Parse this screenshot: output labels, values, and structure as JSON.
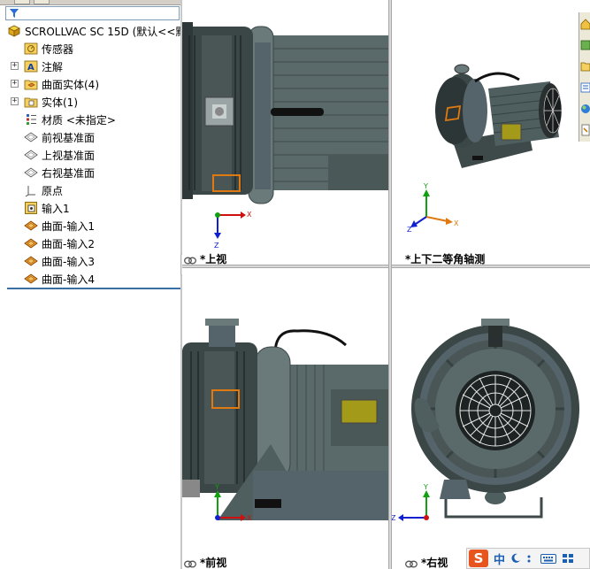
{
  "tree": {
    "root": {
      "label": "SCROLLVAC SC 15D  (默认<<默"
    },
    "items": [
      {
        "label": "传感器",
        "icon": "sensor-icon",
        "expander": false
      },
      {
        "label": "注解",
        "icon": "annotation-icon",
        "expander": true
      },
      {
        "label": "曲面实体(4)",
        "icon": "surface-bodies-folder-icon",
        "expander": true
      },
      {
        "label": "实体(1)",
        "icon": "solid-bodies-folder-icon",
        "expander": true
      },
      {
        "label": "材质 <未指定>",
        "icon": "material-icon",
        "expander": false
      },
      {
        "label": "前视基准面",
        "icon": "plane-icon",
        "expander": false
      },
      {
        "label": "上视基准面",
        "icon": "plane-icon",
        "expander": false
      },
      {
        "label": "右视基准面",
        "icon": "plane-icon",
        "expander": false
      },
      {
        "label": "原点",
        "icon": "origin-icon",
        "expander": false
      },
      {
        "label": "输入1",
        "icon": "imported-body-icon",
        "expander": false
      },
      {
        "label": "曲面-输入1",
        "icon": "imported-surface-icon",
        "expander": false
      },
      {
        "label": "曲面-输入2",
        "icon": "imported-surface-icon",
        "expander": false
      },
      {
        "label": "曲面-输入3",
        "icon": "imported-surface-icon",
        "expander": false
      },
      {
        "label": "曲面-输入4",
        "icon": "imported-surface-icon",
        "expander": false
      }
    ]
  },
  "viewports": {
    "top": {
      "label": "*上视"
    },
    "iso": {
      "label": "*上下二等角轴测"
    },
    "front": {
      "label": "*前视"
    },
    "right": {
      "label": "*右视"
    }
  },
  "axes": {
    "x": "X",
    "y": "Y",
    "z": "Z"
  },
  "ime": {
    "logo": "S",
    "mode": "中"
  },
  "colors": {
    "body": "#4f5f5f",
    "body_dark": "#2f3a3a",
    "highlight": "#e07a10",
    "motor_plate": "#a39a1a",
    "axis_x": "#d01010",
    "axis_y": "#10a010",
    "axis_z": "#1020d0"
  }
}
